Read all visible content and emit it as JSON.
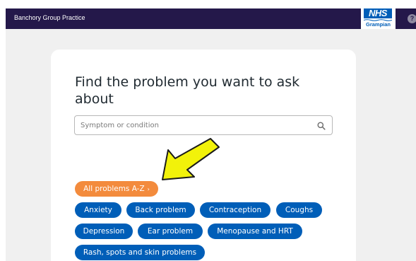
{
  "header": {
    "practice_name": "Banchory Group Practice",
    "logo_text": "NHS",
    "logo_region": "Grampian",
    "help_icon": "?"
  },
  "main": {
    "title": "Find the problem you want to ask about",
    "search": {
      "placeholder": "Symptom or condition",
      "value": "",
      "icon": "search-icon"
    },
    "all_problems_label": "All problems A-Z",
    "all_problems_chevron": "›",
    "topics": [
      "Anxiety",
      "Back problem",
      "Contraception",
      "Coughs",
      "Depression",
      "Ear problem",
      "Menopause and HRT",
      "Rash, spots and skin problems"
    ]
  },
  "colors": {
    "header_bg": "#24184a",
    "nhs_blue": "#005eb8",
    "orange_accent": "#f38b3d",
    "annotation_arrow": "#f2f20a"
  }
}
